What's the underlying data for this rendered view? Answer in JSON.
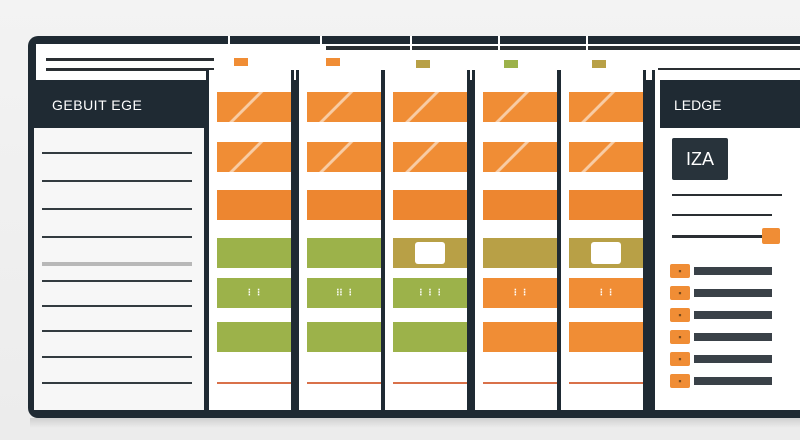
{
  "header": {
    "left_title": "GEBUIT EGE",
    "right_title": "LEDGE"
  },
  "right_panel": {
    "badge_text": "IZA",
    "slider_value": 0.9,
    "list_icon_count": 6
  },
  "columns": [
    {
      "id": "col-1",
      "cells": [
        "orange-stripe",
        "orange-stripe",
        "orange",
        "green",
        "green-dots",
        "green"
      ],
      "dots": "⁝ ⁝"
    },
    {
      "id": "col-2",
      "cells": [
        "orange-stripe",
        "orange-stripe",
        "orange",
        "green",
        "green-dots",
        "green"
      ],
      "dots": "⁝⁝ ⁝"
    },
    {
      "id": "col-3",
      "cells": [
        "orange-stripe",
        "orange-stripe",
        "orange",
        "olive-box",
        "green-dots",
        "green"
      ],
      "dots": "⁝ ⁝ ⁝"
    },
    {
      "id": "col-4",
      "cells": [
        "orange-stripe",
        "orange-stripe",
        "orange",
        "olive",
        "orange-dots",
        "orange"
      ],
      "dots": "⁝ ⁝"
    },
    {
      "id": "col-5",
      "cells": [
        "orange-stripe",
        "orange-stripe",
        "orange",
        "olive-box",
        "orange-dots",
        "orange"
      ],
      "dots": "⁝ ⁝"
    }
  ],
  "colors": {
    "frame": "#1f2a33",
    "accent_orange": "#f08d35",
    "accent_green": "#9cb24a",
    "accent_olive": "#b8a046"
  }
}
